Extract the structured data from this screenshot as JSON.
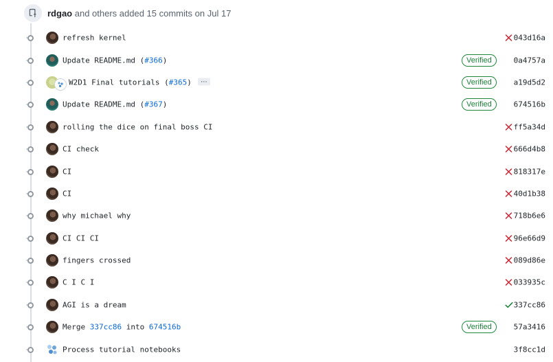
{
  "header": {
    "author": "rdgao",
    "text": "and others added 15 commits",
    "on": "on Jul 17"
  },
  "commits": [
    {
      "message": "refresh kernel",
      "status": "fail",
      "verified": "",
      "sha": "043d16a",
      "avatar": "dark"
    },
    {
      "message_pre": "Update README.md (",
      "pr": "#366",
      "message_post": ")",
      "status": "none",
      "verified": "Verified",
      "sha": "0a4757a",
      "avatar": "teal"
    },
    {
      "message_pre": "W2D1 Final tutorials (",
      "pr": "#365",
      "message_post": ")",
      "ellipsis": "…",
      "status": "none",
      "verified": "Verified",
      "sha": "a19d5d2",
      "avatar": "pair"
    },
    {
      "message_pre": "Update README.md (",
      "pr": "#367",
      "message_post": ")",
      "status": "none",
      "verified": "Verified",
      "sha": "674516b",
      "avatar": "teal"
    },
    {
      "message": "rolling the dice on final boss CI",
      "status": "fail",
      "verified": "",
      "sha": "ff5a34d",
      "avatar": "dark"
    },
    {
      "message": "CI check",
      "status": "fail",
      "verified": "",
      "sha": "666d4b8",
      "avatar": "dark"
    },
    {
      "message": "CI",
      "status": "fail",
      "verified": "",
      "sha": "818317e",
      "avatar": "dark"
    },
    {
      "message": "CI",
      "status": "fail",
      "verified": "",
      "sha": "40d1b38",
      "avatar": "dark"
    },
    {
      "message": "why michael why",
      "status": "fail",
      "verified": "",
      "sha": "718b6e6",
      "avatar": "dark"
    },
    {
      "message": "CI CI CI",
      "status": "fail",
      "verified": "",
      "sha": "96e66d9",
      "avatar": "dark"
    },
    {
      "message": "fingers crossed",
      "status": "fail",
      "verified": "",
      "sha": "089d86e",
      "avatar": "dark"
    },
    {
      "message": "C I C I",
      "status": "fail",
      "verified": "",
      "sha": "033935c",
      "avatar": "dark"
    },
    {
      "message": "AGI is a dream",
      "status": "success",
      "verified": "",
      "sha": "337cc86",
      "avatar": "dark"
    },
    {
      "message_pre": "Merge ",
      "ref1": "337cc86",
      "message_mid": " into ",
      "ref2": "674516b",
      "status": "none",
      "verified": "Verified",
      "sha": "57a3416",
      "avatar": "dark"
    },
    {
      "message": "Process tutorial notebooks",
      "status": "none",
      "verified": "",
      "sha": "3f8cc1d",
      "avatar": "bot"
    }
  ],
  "colors": {
    "fail": "#cf222e",
    "success": "#1a7f37",
    "link": "#0969da",
    "verified_border": "#1f883d"
  },
  "icons": {
    "header": "repo-push-icon",
    "fail": "x-icon",
    "success": "check-icon"
  }
}
